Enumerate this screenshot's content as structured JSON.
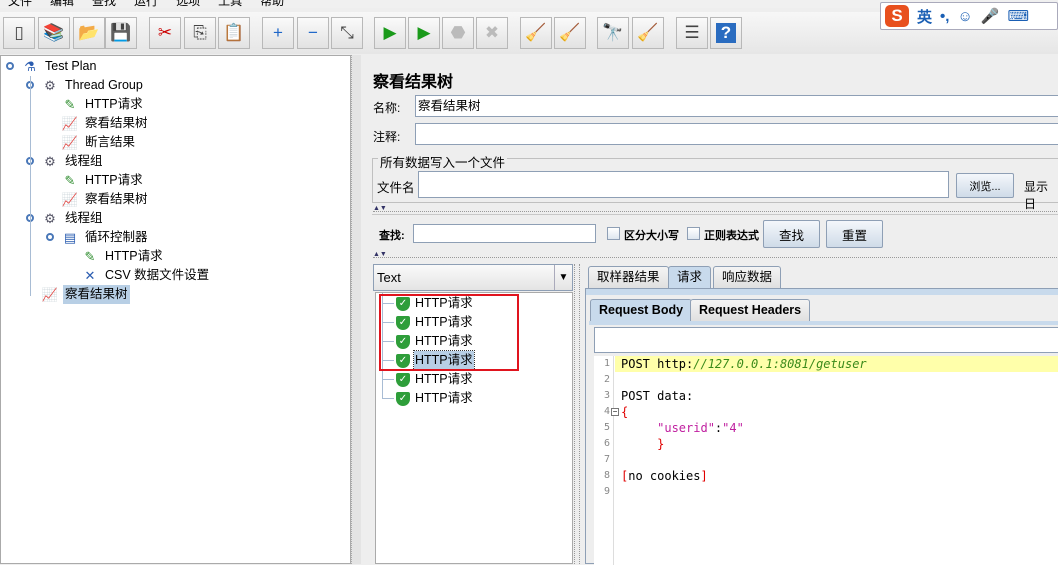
{
  "menu": [
    "文件",
    "编辑",
    "查找",
    "运行",
    "选项",
    "工具",
    "帮助"
  ],
  "toolbar": [
    {
      "name": "new-icon",
      "glyph": "▯"
    },
    {
      "name": "templates-icon",
      "glyph": "📚"
    },
    {
      "name": "open-icon",
      "glyph": "📂"
    },
    {
      "name": "save-icon",
      "glyph": "💾"
    },
    {
      "name": "cut-icon",
      "glyph": "✂"
    },
    {
      "name": "copy-icon",
      "glyph": "⎘"
    },
    {
      "name": "paste-icon",
      "glyph": "📋"
    },
    {
      "name": "expand-icon",
      "glyph": "+"
    },
    {
      "name": "collapse-icon",
      "glyph": "−"
    },
    {
      "name": "toggle-icon",
      "glyph": "⤡"
    },
    {
      "name": "start-icon",
      "glyph": "▶"
    },
    {
      "name": "start-no-pause-icon",
      "glyph": "▶"
    },
    {
      "name": "stop-icon",
      "glyph": "⬣"
    },
    {
      "name": "shutdown-icon",
      "glyph": "✖"
    },
    {
      "name": "clear-icon",
      "glyph": "🧹"
    },
    {
      "name": "clear-all-icon",
      "glyph": "🧹"
    },
    {
      "name": "search-icon",
      "glyph": "🔭"
    },
    {
      "name": "reset-search-icon",
      "glyph": "🧹"
    },
    {
      "name": "function-helper-icon",
      "glyph": "☰"
    },
    {
      "name": "help-icon",
      "glyph": "?"
    }
  ],
  "ime": {
    "logo": "S",
    "lang": "英",
    "punct": "•,",
    "emoji": "☺",
    "mic": "🎤",
    "keyboard": "⌨"
  },
  "tree": [
    {
      "label": "Test Plan",
      "icon": "flask-icon",
      "glyph": "⚗",
      "level": 0
    },
    {
      "label": "Thread Group",
      "icon": "gear-icon",
      "glyph": "⚙",
      "level": 1
    },
    {
      "label": "HTTP请求",
      "icon": "pipette-icon",
      "glyph": "✎",
      "level": 2
    },
    {
      "label": "察看结果树",
      "icon": "graph-icon",
      "glyph": "📈",
      "level": 2
    },
    {
      "label": "断言结果",
      "icon": "graph-icon",
      "glyph": "📈",
      "level": 2
    },
    {
      "label": "线程组",
      "icon": "gear-icon",
      "glyph": "⚙",
      "level": 1
    },
    {
      "label": "HTTP请求",
      "icon": "pipette-icon",
      "glyph": "✎",
      "level": 2
    },
    {
      "label": "察看结果树",
      "icon": "graph-icon",
      "glyph": "📈",
      "level": 2
    },
    {
      "label": "线程组",
      "icon": "gear-icon",
      "glyph": "⚙",
      "level": 1
    },
    {
      "label": "循环控制器",
      "icon": "loop-controller-icon",
      "glyph": "▤",
      "level": 2
    },
    {
      "label": "HTTP请求",
      "icon": "pipette-icon",
      "glyph": "✎",
      "level": 3
    },
    {
      "label": "CSV 数据文件设置",
      "icon": "tools-icon",
      "glyph": "✕",
      "level": 3
    },
    {
      "label": "察看结果树",
      "icon": "graph-icon",
      "glyph": "📈",
      "level": 1,
      "selected": true
    }
  ],
  "panel": {
    "title": "察看结果树",
    "name_label": "名称:",
    "name_value": "察看结果树",
    "comment_label": "注释:",
    "comment_value": "",
    "file_group": "所有数据写入一个文件",
    "filename_label": "文件名",
    "filename_value": "",
    "browse": "浏览...",
    "display": "显示日",
    "search_label": "查找:",
    "search_value": "",
    "case_sensitive": "区分大小写",
    "regex": "正则表达式",
    "find": "查找",
    "reset": "重置"
  },
  "renderer": "Text",
  "results": [
    {
      "label": "HTTP请求",
      "status": "success"
    },
    {
      "label": "HTTP请求",
      "status": "success"
    },
    {
      "label": "HTTP请求",
      "status": "success"
    },
    {
      "label": "HTTP请求",
      "status": "success",
      "selected": true
    },
    {
      "label": "HTTP请求",
      "status": "success"
    },
    {
      "label": "HTTP请求",
      "status": "success"
    }
  ],
  "tabs": [
    "取样器结果",
    "请求",
    "响应数据"
  ],
  "active_tab": 1,
  "subtabs": [
    "Request Body",
    "Request Headers"
  ],
  "code": [
    {
      "n": "1",
      "parts": [
        {
          "t": "POST http:",
          "c": "#000"
        },
        {
          "t": "//127.0.0.1:8081/getuser",
          "c": "#3a8a1a",
          "i": true
        }
      ],
      "hl": true
    },
    {
      "n": "2",
      "parts": []
    },
    {
      "n": "3",
      "parts": [
        {
          "t": "POST data:",
          "c": "#000"
        }
      ]
    },
    {
      "n": "4",
      "parts": [
        {
          "t": "{",
          "c": "#e00000"
        }
      ],
      "fold": true
    },
    {
      "n": "5",
      "parts": [
        {
          "t": "     \"userid\"",
          "c": "#c020a0"
        },
        {
          "t": ":",
          "c": "#000"
        },
        {
          "t": "\"4\"",
          "c": "#c020a0"
        }
      ]
    },
    {
      "n": "6",
      "parts": [
        {
          "t": "     }",
          "c": "#e00000"
        }
      ]
    },
    {
      "n": "7",
      "parts": []
    },
    {
      "n": "8",
      "parts": [
        {
          "t": "[",
          "c": "#e00000"
        },
        {
          "t": "no cookies",
          "c": "#000"
        },
        {
          "t": "]",
          "c": "#e00000"
        }
      ]
    },
    {
      "n": "9",
      "parts": []
    }
  ],
  "colors": {
    "highlight_box": "#e0141e",
    "selection": "#b8cfe5",
    "line_highlight": "#ffffaa"
  }
}
